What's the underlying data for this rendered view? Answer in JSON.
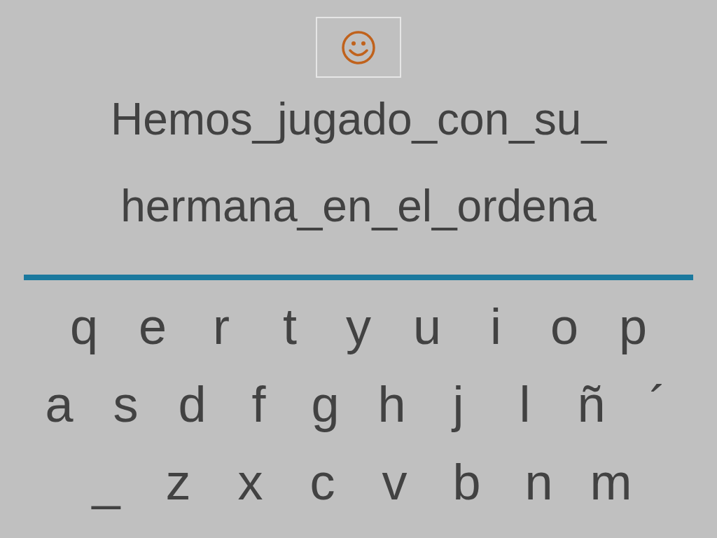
{
  "sentence_lines": [
    "Hemos_jugado_con_su_",
    "hermana_en_el_ordena"
  ],
  "keyboard_rows": [
    [
      "q",
      "e",
      "r",
      "t",
      "y",
      "u",
      "i",
      "o",
      "p"
    ],
    [
      "a",
      "s",
      "d",
      "f",
      "g",
      "h",
      "j",
      "l",
      "ñ",
      "´"
    ],
    [
      "_",
      "z",
      "x",
      "c",
      "v",
      "b",
      "n",
      "m"
    ]
  ]
}
